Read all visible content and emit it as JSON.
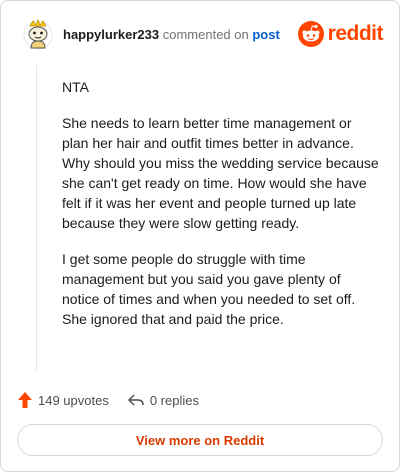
{
  "header": {
    "username": "happylurker233",
    "commented_text": "commented on",
    "post_link": "post",
    "brand": "reddit"
  },
  "comment": {
    "paragraphs": [
      "NTA",
      "She needs to learn better time management or plan her hair and outfit times better in advance. Why should you miss the wedding service because she can't get ready on time. How would she have felt if it was her event and people turned up late because they were slow getting ready.",
      "I get some people do struggle with time management but you said you gave plenty of notice of times and when you needed to set off. She ignored that and paid the price."
    ]
  },
  "actions": {
    "upvotes": "149 upvotes",
    "replies": "0 replies"
  },
  "footer": {
    "view_more": "View more on Reddit"
  },
  "colors": {
    "brand": "#ff4500",
    "link": "#0a5fcf",
    "view_more": "#d93a00"
  },
  "icons": [
    "avatar-icon",
    "reddit-logo-icon",
    "upvote-arrow-icon",
    "reply-icon"
  ]
}
